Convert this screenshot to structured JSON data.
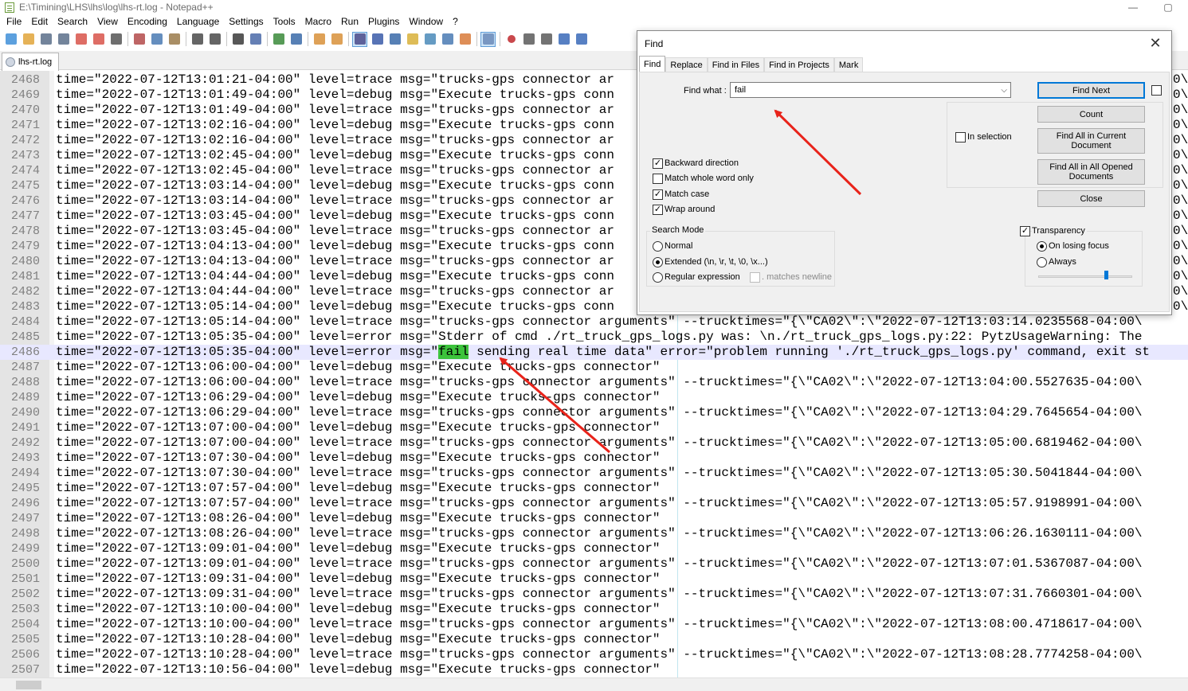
{
  "window": {
    "title": "E:\\Timining\\LHS\\lhs\\log\\lhs-rt.log - Notepad++",
    "minimize": "—",
    "maximize": "▢"
  },
  "menu": [
    "File",
    "Edit",
    "Search",
    "View",
    "Encoding",
    "Language",
    "Settings",
    "Tools",
    "Macro",
    "Run",
    "Plugins",
    "Window",
    "?"
  ],
  "toolbar_icons": [
    "new-file-icon",
    "open-file-icon",
    "save-icon",
    "save-all-icon",
    "close-icon",
    "close-all-icon",
    "print-icon",
    "cut-icon",
    "copy-icon",
    "paste-icon",
    "undo-icon",
    "redo-icon",
    "find-icon",
    "replace-icon",
    "zoom-in-icon",
    "zoom-out-icon",
    "sync-vertical-icon",
    "sync-horizontal-icon",
    "word-wrap-icon",
    "show-all-characters-icon",
    "indent-guide-icon",
    "user-language-icon",
    "document-map-icon",
    "function-list-icon",
    "folder-workspace-icon",
    "monitoring-icon",
    "record-macro-icon",
    "stop-recording-icon",
    "playback-macro-icon",
    "run-macro-multiple-icon",
    "save-macro-icon"
  ],
  "tab": {
    "label": "lhs-rt.log"
  },
  "editor": {
    "current_line": 2486,
    "match_text": "fail",
    "lines": [
      {
        "n": "2468",
        "t": "time=\"2022-07-12T13:01:21-04:00\" level=trace msg=\"trucks-gps connector ar"
      },
      {
        "n": "2469",
        "t": "time=\"2022-07-12T13:01:49-04:00\" level=debug msg=\"Execute trucks-gps conn"
      },
      {
        "n": "2470",
        "t": "time=\"2022-07-12T13:01:49-04:00\" level=trace msg=\"trucks-gps connector ar"
      },
      {
        "n": "2471",
        "t": "time=\"2022-07-12T13:02:16-04:00\" level=debug msg=\"Execute trucks-gps conn"
      },
      {
        "n": "2472",
        "t": "time=\"2022-07-12T13:02:16-04:00\" level=trace msg=\"trucks-gps connector ar"
      },
      {
        "n": "2473",
        "t": "time=\"2022-07-12T13:02:45-04:00\" level=debug msg=\"Execute trucks-gps conn"
      },
      {
        "n": "2474",
        "t": "time=\"2022-07-12T13:02:45-04:00\" level=trace msg=\"trucks-gps connector ar"
      },
      {
        "n": "2475",
        "t": "time=\"2022-07-12T13:03:14-04:00\" level=debug msg=\"Execute trucks-gps conn"
      },
      {
        "n": "2476",
        "t": "time=\"2022-07-12T13:03:14-04:00\" level=trace msg=\"trucks-gps connector ar"
      },
      {
        "n": "2477",
        "t": "time=\"2022-07-12T13:03:45-04:00\" level=debug msg=\"Execute trucks-gps conn"
      },
      {
        "n": "2478",
        "t": "time=\"2022-07-12T13:03:45-04:00\" level=trace msg=\"trucks-gps connector ar"
      },
      {
        "n": "2479",
        "t": "time=\"2022-07-12T13:04:13-04:00\" level=debug msg=\"Execute trucks-gps conn"
      },
      {
        "n": "2480",
        "t": "time=\"2022-07-12T13:04:13-04:00\" level=trace msg=\"trucks-gps connector ar"
      },
      {
        "n": "2481",
        "t": "time=\"2022-07-12T13:04:44-04:00\" level=debug msg=\"Execute trucks-gps conn"
      },
      {
        "n": "2482",
        "t": "time=\"2022-07-12T13:04:44-04:00\" level=trace msg=\"trucks-gps connector ar"
      },
      {
        "n": "2483",
        "t": "time=\"2022-07-12T13:05:14-04:00\" level=debug msg=\"Execute trucks-gps conn"
      },
      {
        "n": "2484",
        "t": "time=\"2022-07-12T13:05:14-04:00\" level=trace msg=\"trucks-gps connector arguments\" --trucktimes=\"{\\\"CA02\\\":\\\"2022-07-12T13:03:14.0235568-04:00\\"
      },
      {
        "n": "2485",
        "t": "time=\"2022-07-12T13:05:35-04:00\" level=error msg=\"Stderr of cmd ./rt_truck_gps_logs.py was: \\n./rt_truck_gps_logs.py:22: PytzUsageWarning: The"
      },
      {
        "n": "2486",
        "pre": "time=\"2022-07-12T13:05:35-04:00\" level=error msg=\"",
        "post": " sending real time data\" error=\"problem running './rt_truck_gps_logs.py' command, exit st"
      },
      {
        "n": "2487",
        "t": "time=\"2022-07-12T13:06:00-04:00\" level=debug msg=\"Execute trucks-gps connector\""
      },
      {
        "n": "2488",
        "t": "time=\"2022-07-12T13:06:00-04:00\" level=trace msg=\"trucks-gps connector arguments\" --trucktimes=\"{\\\"CA02\\\":\\\"2022-07-12T13:04:00.5527635-04:00\\"
      },
      {
        "n": "2489",
        "t": "time=\"2022-07-12T13:06:29-04:00\" level=debug msg=\"Execute trucks-gps connector\""
      },
      {
        "n": "2490",
        "t": "time=\"2022-07-12T13:06:29-04:00\" level=trace msg=\"trucks-gps connector arguments\" --trucktimes=\"{\\\"CA02\\\":\\\"2022-07-12T13:04:29.7645654-04:00\\"
      },
      {
        "n": "2491",
        "t": "time=\"2022-07-12T13:07:00-04:00\" level=debug msg=\"Execute trucks-gps connector\""
      },
      {
        "n": "2492",
        "t": "time=\"2022-07-12T13:07:00-04:00\" level=trace msg=\"trucks-gps connector arguments\" --trucktimes=\"{\\\"CA02\\\":\\\"2022-07-12T13:05:00.6819462-04:00\\"
      },
      {
        "n": "2493",
        "t": "time=\"2022-07-12T13:07:30-04:00\" level=debug msg=\"Execute trucks-gps connector\""
      },
      {
        "n": "2494",
        "t": "time=\"2022-07-12T13:07:30-04:00\" level=trace msg=\"trucks-gps connector arguments\" --trucktimes=\"{\\\"CA02\\\":\\\"2022-07-12T13:05:30.5041844-04:00\\"
      },
      {
        "n": "2495",
        "t": "time=\"2022-07-12T13:07:57-04:00\" level=debug msg=\"Execute trucks-gps connector\""
      },
      {
        "n": "2496",
        "t": "time=\"2022-07-12T13:07:57-04:00\" level=trace msg=\"trucks-gps connector arguments\" --trucktimes=\"{\\\"CA02\\\":\\\"2022-07-12T13:05:57.9198991-04:00\\"
      },
      {
        "n": "2497",
        "t": "time=\"2022-07-12T13:08:26-04:00\" level=debug msg=\"Execute trucks-gps connector\""
      },
      {
        "n": "2498",
        "t": "time=\"2022-07-12T13:08:26-04:00\" level=trace msg=\"trucks-gps connector arguments\" --trucktimes=\"{\\\"CA02\\\":\\\"2022-07-12T13:06:26.1630111-04:00\\"
      },
      {
        "n": "2499",
        "t": "time=\"2022-07-12T13:09:01-04:00\" level=debug msg=\"Execute trucks-gps connector\""
      },
      {
        "n": "2500",
        "t": "time=\"2022-07-12T13:09:01-04:00\" level=trace msg=\"trucks-gps connector arguments\" --trucktimes=\"{\\\"CA02\\\":\\\"2022-07-12T13:07:01.5367087-04:00\\"
      },
      {
        "n": "2501",
        "t": "time=\"2022-07-12T13:09:31-04:00\" level=debug msg=\"Execute trucks-gps connector\""
      },
      {
        "n": "2502",
        "t": "time=\"2022-07-12T13:09:31-04:00\" level=trace msg=\"trucks-gps connector arguments\" --trucktimes=\"{\\\"CA02\\\":\\\"2022-07-12T13:07:31.7660301-04:00\\"
      },
      {
        "n": "2503",
        "t": "time=\"2022-07-12T13:10:00-04:00\" level=debug msg=\"Execute trucks-gps connector\""
      },
      {
        "n": "2504",
        "t": "time=\"2022-07-12T13:10:00-04:00\" level=trace msg=\"trucks-gps connector arguments\" --trucktimes=\"{\\\"CA02\\\":\\\"2022-07-12T13:08:00.4718617-04:00\\"
      },
      {
        "n": "2505",
        "t": "time=\"2022-07-12T13:10:28-04:00\" level=debug msg=\"Execute trucks-gps connector\""
      },
      {
        "n": "2506",
        "t": "time=\"2022-07-12T13:10:28-04:00\" level=trace msg=\"trucks-gps connector arguments\" --trucktimes=\"{\\\"CA02\\\":\\\"2022-07-12T13:08:28.7774258-04:00\\"
      },
      {
        "n": "2507",
        "t": "time=\"2022-07-12T13:10:56-04:00\" level=debug msg=\"Execute trucks-gps connector\""
      }
    ]
  },
  "edge_fragments": [
    "0\\",
    "0\\",
    "0\\",
    "0\\",
    "0\\",
    "0\\",
    "0\\",
    "0\\",
    "0\\",
    "0\\",
    "0\\",
    "0\\",
    "0\\",
    "0\\",
    "0\\",
    "0\\"
  ],
  "find_dialog": {
    "title": "Find",
    "close": "✕",
    "tabs": [
      "Find",
      "Replace",
      "Find in Files",
      "Find in Projects",
      "Mark"
    ],
    "find_what_label": "Find what :",
    "find_what_value": "fail",
    "buttons": {
      "find_next": "Find Next",
      "count": "Count",
      "find_all_current": "Find All in Current Document",
      "find_all_opened": "Find All in All Opened Documents",
      "close": "Close"
    },
    "in_selection": "In selection",
    "options": [
      {
        "label": "Backward direction",
        "checked": true
      },
      {
        "label": "Match whole word only",
        "checked": false
      },
      {
        "label": "Match case",
        "checked": true
      },
      {
        "label": "Wrap around",
        "checked": true
      }
    ],
    "search_mode": {
      "title": "Search Mode",
      "normal": "Normal",
      "extended": "Extended (\\n, \\r, \\t, \\0, \\x...)",
      "regex": "Regular expression",
      "matches_newline": ". matches newline",
      "selected": "extended"
    },
    "transparency": {
      "title": "Transparency",
      "checked": true,
      "on_losing_focus": "On losing focus",
      "always": "Always",
      "selected": "on_losing_focus",
      "level": 0.7
    }
  },
  "colors": {
    "highlight": "#3cc33c",
    "arrow": "#e8231a",
    "accent": "#0078d7"
  }
}
